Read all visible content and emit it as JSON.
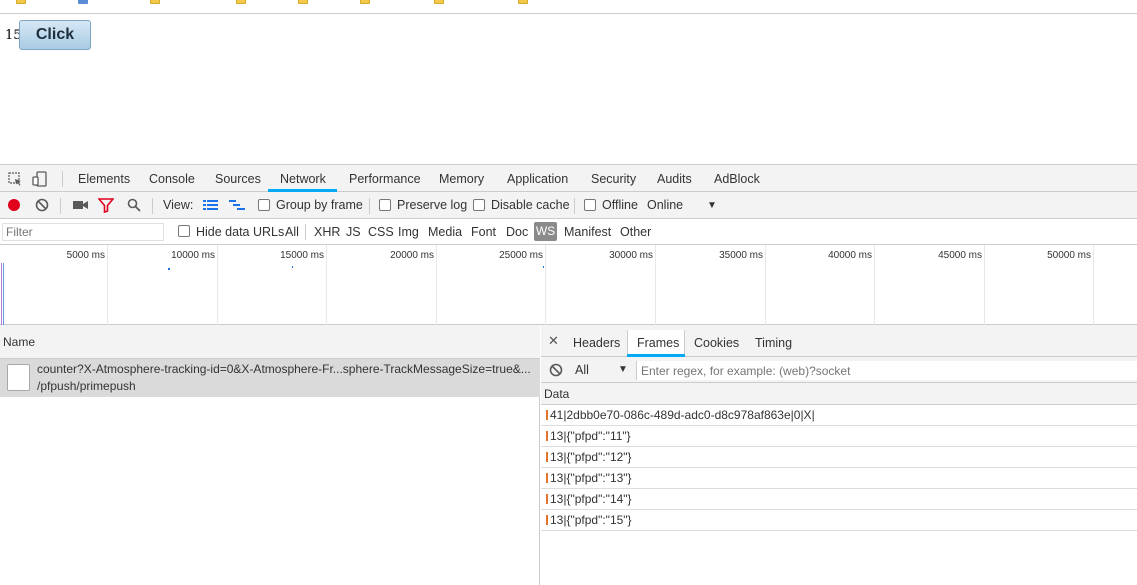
{
  "app": {
    "counter_value": "15",
    "button_label": "Click"
  },
  "devtools": {
    "tabs": [
      "Elements",
      "Console",
      "Sources",
      "Network",
      "Performance",
      "Memory",
      "Application",
      "Security",
      "Audits",
      "AdBlock"
    ],
    "active_tab": "Network",
    "toolbar": {
      "view_label": "View:",
      "group_by_frame": "Group by frame",
      "preserve_log": "Preserve log",
      "disable_cache": "Disable cache",
      "offline": "Offline",
      "throttle": "Online"
    },
    "filter": {
      "placeholder": "Filter",
      "hide_data_urls": "Hide data URLs",
      "types": [
        "All",
        "XHR",
        "JS",
        "CSS",
        "Img",
        "Media",
        "Font",
        "Doc",
        "WS",
        "Manifest",
        "Other"
      ],
      "active_type": "WS"
    },
    "timeline_ticks": [
      "5000 ms",
      "10000 ms",
      "15000 ms",
      "20000 ms",
      "25000 ms",
      "30000 ms",
      "35000 ms",
      "40000 ms",
      "45000 ms",
      "50000 ms"
    ],
    "requests": {
      "column": "Name",
      "items": [
        {
          "name": "counter?X-Atmosphere-tracking-id=0&X-Atmosphere-Fr...sphere-TrackMessageSize=true&...",
          "path": "/pfpush/primepush"
        }
      ]
    },
    "detail": {
      "tabs": [
        "Headers",
        "Frames",
        "Cookies",
        "Timing"
      ],
      "active_tab": "Frames",
      "frame_filter_select": "All",
      "regex_placeholder": "Enter regex, for example: (web)?socket",
      "data_column": "Data",
      "frames": [
        "41|2dbb0e70-086c-489d-adc0-d8c978af863e|0|X|",
        "13|{\"pfpd\":\"11\"}",
        "13|{\"pfpd\":\"12\"}",
        "13|{\"pfpd\":\"13\"}",
        "13|{\"pfpd\":\"14\"}",
        "13|{\"pfpd\":\"15\"}"
      ]
    }
  }
}
